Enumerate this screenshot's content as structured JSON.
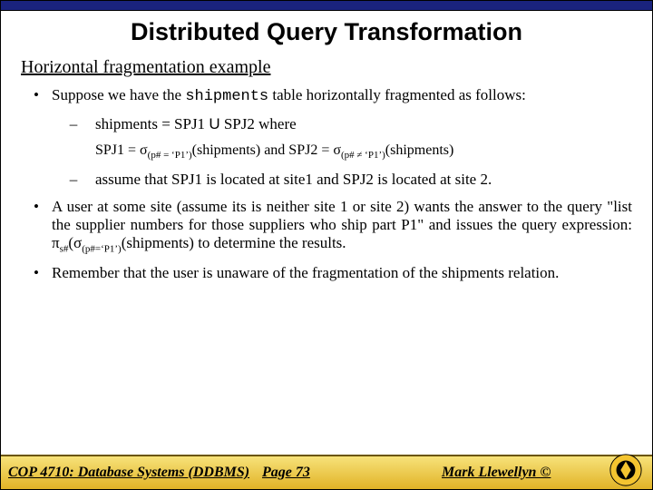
{
  "title": "Distributed Query Transformation",
  "subtitle": "Horizontal fragmentation example",
  "bullets": {
    "b0": {
      "pre": "Suppose we have the ",
      "code": "shipments",
      "post": " table horizontally fragmented as follows:"
    },
    "s0": {
      "pre": "shipments = SPJ1 ",
      "union": "U",
      "post": " SPJ2 where"
    },
    "formula": {
      "a1": "SPJ1 = σ",
      "sub1": "(p# = ‘P1’)",
      "a2": "(shipments)  and SPJ2 = σ",
      "sub2": "(p# ≠ ‘P1’)",
      "a3": "(shipments)"
    },
    "s1": "assume that SPJ1 is located at site1 and SPJ2 is located at site 2.",
    "b1": {
      "p1": "A user at some site (assume its is neither site 1 or site 2) wants the answer to the query \"list the supplier numbers for those suppliers who ship part P1\" and issues the query expression: π",
      "sub1": "s#",
      "p2": "(σ",
      "sub2": "(p#=‘P1’)",
      "p3": "(shipments) to determine the results."
    },
    "b2": "Remember that the user is unaware of the fragmentation of the shipments relation."
  },
  "footer": {
    "course": "COP 4710: Database Systems  (DDBMS)",
    "page": "Page 73",
    "author": "Mark Llewellyn ©"
  }
}
